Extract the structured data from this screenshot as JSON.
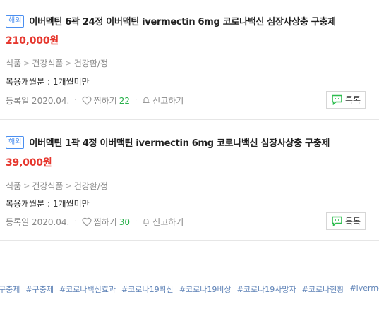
{
  "items": [
    {
      "badge": "해외",
      "title": "이버멕틴 6곽 24정 이버맥틴 ivermectin 6mg 코로나백신 심장사상충 구충제",
      "price": "210,000원",
      "categories": [
        "식품",
        "건강식품",
        "건강환/정"
      ],
      "attr_label": "복용개월분 : ",
      "attr_value": "1개월미만",
      "date": "등록일 2020.04.",
      "like_label": "찜하기",
      "like_count": "22",
      "report_label": "신고하기",
      "talk_label": "톡톡"
    },
    {
      "badge": "해외",
      "title": "이버멕틴 1곽 4정 이버맥틴 ivermectin 6mg 코로나백신 심장사상충 구충제",
      "price": "39,000원",
      "categories": [
        "식품",
        "건강식품",
        "건강환/정"
      ],
      "attr_label": "복용개월분 : ",
      "attr_value": "1개월미만",
      "date": "등록일 2020.04.",
      "like_label": "찜하기",
      "like_count": "30",
      "report_label": "신고하기",
      "talk_label": "톡톡"
    }
  ],
  "tags": [
    "구충제",
    "#구충제",
    "#코로나백신효과",
    "#코로나19확산",
    "#코로나19비상",
    "#코로나19사망자",
    "#코로나현황",
    "#ivermectin"
  ],
  "colors": {
    "price": "#e6372e",
    "badge": "#4b8ff0",
    "like_count": "#28b04a",
    "talk_icon": "#2dbd4f",
    "tag": "#5f83b7"
  },
  "icons": {
    "like": "heart-icon",
    "report": "bell-icon",
    "talk": "chat-bubble-icon"
  }
}
